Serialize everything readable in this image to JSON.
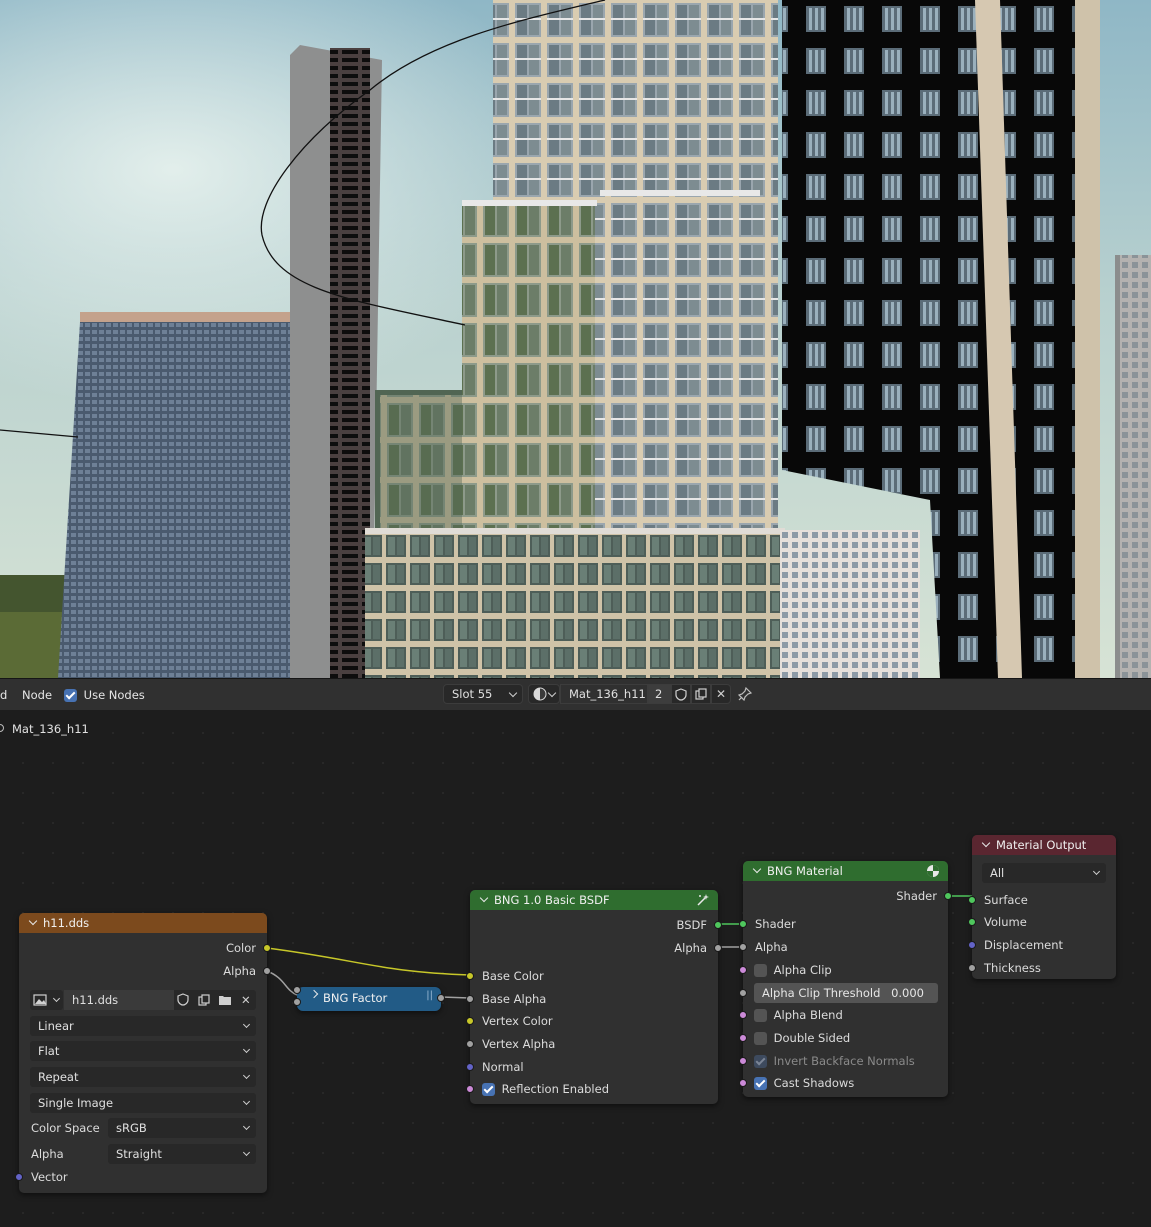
{
  "header": {
    "menu_left_fragment": "d",
    "menu_node": "Node",
    "use_nodes_label": "Use Nodes",
    "use_nodes_checked": true,
    "slot_label": "Slot 55",
    "material_name": "Mat_136_h11",
    "user_count": "2"
  },
  "breadcrumb": "Mat_136_h11",
  "nodes": {
    "image": {
      "title": "h11.dds",
      "out_color": "Color",
      "out_alpha": "Alpha",
      "image_name": "h11.dds",
      "interpolation": "Linear",
      "projection": "Flat",
      "extension": "Repeat",
      "source": "Single Image",
      "colorspace_label": "Color Space",
      "colorspace_value": "sRGB",
      "alpha_label": "Alpha",
      "alpha_value": "Straight",
      "in_vector": "Vector"
    },
    "factor": {
      "title": "BNG Factor"
    },
    "bsdf": {
      "title": "BNG 1.0 Basic BSDF",
      "out_bsdf": "BSDF",
      "out_alpha": "Alpha",
      "in_base_color": "Base Color",
      "in_base_alpha": "Base Alpha",
      "in_vertex_color": "Vertex Color",
      "in_vertex_alpha": "Vertex Alpha",
      "in_normal": "Normal",
      "reflection_label": "Reflection Enabled",
      "reflection_checked": true
    },
    "bng_material": {
      "title": "BNG Material",
      "out_shader": "Shader",
      "in_shader": "Shader",
      "in_alpha": "Alpha",
      "alpha_clip": "Alpha Clip",
      "alpha_clip_threshold_label": "Alpha Clip Threshold",
      "alpha_clip_threshold_value": "0.000",
      "alpha_blend": "Alpha Blend",
      "double_sided": "Double Sided",
      "invert_backface": "Invert Backface Normals",
      "cast_shadows": "Cast Shadows"
    },
    "material_output": {
      "title": "Material Output",
      "target": "All",
      "in_surface": "Surface",
      "in_volume": "Volume",
      "in_displacement": "Displacement",
      "in_thickness": "Thickness"
    }
  },
  "colors": {
    "image_header": "#7c4a1d",
    "shader_header": "#2f6d2f",
    "output_header": "#5a2630",
    "group_header": "#225b86",
    "socket_color": "#c7c729",
    "socket_shader": "#4fc75d",
    "socket_float": "#a1a1a1",
    "socket_vector": "#6363c7"
  },
  "icons": [
    "checkbox-icon",
    "material-sphere-icon",
    "shield-icon",
    "duplicate-icon",
    "close-icon",
    "pin-icon",
    "image-icon",
    "folder-icon",
    "wand-icon",
    "globe-icon"
  ]
}
